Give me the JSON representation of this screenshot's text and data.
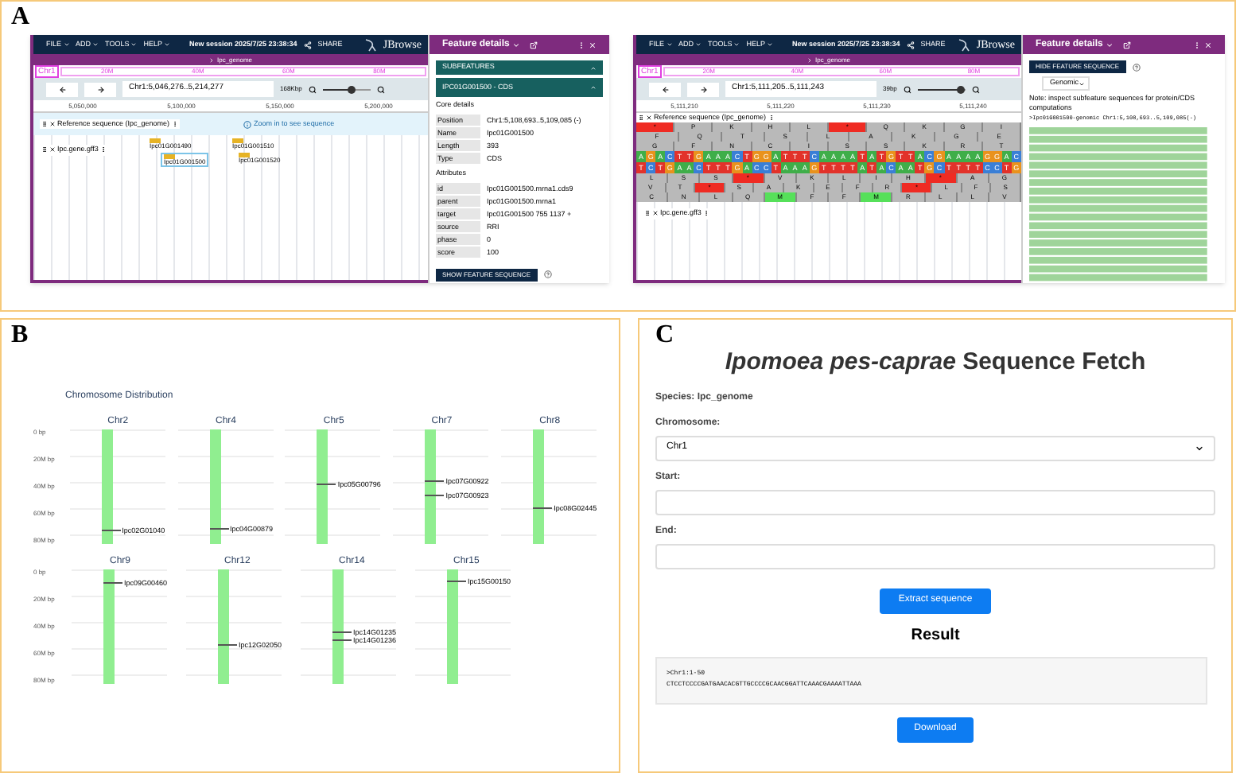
{
  "panel_a": {
    "label": "A",
    "browsers": [
      {
        "kind": "features",
        "menu": [
          "FILE",
          "ADD",
          "TOOLS",
          "HELP"
        ],
        "session": "New session 2025/7/25 23:38:34",
        "share": "SHARE",
        "brand": "JBrowse",
        "details_title": "Feature details",
        "assembly": "Ipc_genome",
        "chromosome": "Chr1",
        "overview_marks": [
          "20M",
          "40M",
          "60M",
          "80M"
        ],
        "locus": "Chr1:5,046,276..5,214,277",
        "zoom_reading": "168Kbp",
        "zoom": {
          "level": 0.6
        },
        "scale": [
          "5,050,000",
          "5,100,000",
          "5,150,000",
          "5,200,000"
        ],
        "reference_track": {
          "name": "Reference sequence (Ipc_genome)",
          "message": "Zoom in to see sequence"
        },
        "gene_track": {
          "name": "Ipc.gene.gff3",
          "features": [
            {
              "label": "Ipc01G001490",
              "selected": false
            },
            {
              "label": "Ipc01G001500",
              "selected": true
            },
            {
              "label": "Ipc01G001510",
              "selected": false
            },
            {
              "label": "Ipc01G001520",
              "selected": false
            }
          ]
        },
        "details": {
          "subfeatures": "SUBFEATURES",
          "feature_title": "IPC01G001500 - CDS",
          "core_title": "Core details",
          "core": [
            {
              "key": "Position",
              "value": "Chr1:5,108,693..5,109,085 (-)"
            },
            {
              "key": "Name",
              "value": "Ipc01G001500"
            },
            {
              "key": "Length",
              "value": "393"
            },
            {
              "key": "Type",
              "value": "CDS"
            }
          ],
          "attributes_title": "Attributes",
          "attributes": [
            {
              "key": "id",
              "value": "Ipc01G001500.mrna1.cds9"
            },
            {
              "key": "parent",
              "value": "Ipc01G001500.mrna1"
            },
            {
              "key": "target",
              "value": "Ipc01G001500 755 1137 +"
            },
            {
              "key": "source",
              "value": "RRI"
            },
            {
              "key": "phase",
              "value": "0"
            },
            {
              "key": "score",
              "value": "100"
            }
          ],
          "button": "SHOW FEATURE SEQUENCE"
        }
      },
      {
        "kind": "sequence",
        "menu": [
          "FILE",
          "ADD",
          "TOOLS",
          "HELP"
        ],
        "session": "New session 2025/7/25 23:38:34",
        "share": "SHARE",
        "brand": "JBrowse",
        "details_title": "Feature details",
        "assembly": "Ipc_genome",
        "chromosome": "Chr1",
        "overview_marks": [
          "20M",
          "40M",
          "60M",
          "80M"
        ],
        "locus": "Chr1:5,111,205..5,111,243",
        "zoom_reading": "39bp",
        "zoom": {
          "level": 0.9
        },
        "scale": [
          "5,111,210",
          "5,111,220",
          "5,111,230",
          "5,111,240"
        ],
        "reference_track": {
          "name": "Reference sequence (Ipc_genome)",
          "frames_top": [
            [
              "*",
              "P",
              "K",
              "H",
              "L",
              "*",
              "Q",
              "K",
              "G",
              "I"
            ],
            [
              "F",
              "Q",
              "T",
              "S",
              "L",
              "A",
              "K",
              "G",
              "E"
            ],
            [
              "G",
              "F",
              "N",
              "C",
              "I",
              "S",
              "S",
              "K",
              "R",
              "T"
            ]
          ],
          "forward": [
            "A",
            "G",
            "A",
            "C",
            "T",
            "T",
            "G",
            "A",
            "A",
            "A",
            "C",
            "T",
            "G",
            "G",
            "A",
            "T",
            "T",
            "T",
            "C",
            "A",
            "A",
            "A",
            "A",
            "T",
            "A",
            "T",
            "G",
            "T",
            "T",
            "A",
            "C",
            "G",
            "A",
            "A",
            "A",
            "A",
            "G",
            "G",
            "A",
            "C"
          ],
          "reverse": [
            "T",
            "C",
            "T",
            "G",
            "A",
            "A",
            "C",
            "T",
            "T",
            "T",
            "G",
            "A",
            "C",
            "C",
            "T",
            "A",
            "A",
            "A",
            "G",
            "T",
            "T",
            "T",
            "T",
            "A",
            "T",
            "A",
            "C",
            "A",
            "A",
            "T",
            "G",
            "C",
            "T",
            "T",
            "T",
            "T",
            "C",
            "C",
            "T",
            "G"
          ],
          "frames_bottom": [
            [
              "L",
              "S",
              "S",
              "*",
              "V",
              "K",
              "L",
              "I",
              "H",
              "*",
              "A",
              "G"
            ],
            [
              "V",
              "T",
              "*",
              "S",
              "A",
              "K",
              "E",
              "F",
              "R",
              "*",
              "L",
              "F",
              "S"
            ],
            [
              "C",
              "N",
              "L",
              "Q",
              "M",
              "F",
              "F",
              "M",
              "R",
              "L",
              "L",
              "V"
            ]
          ]
        },
        "gene_track": {
          "name": "Ipc.gene.gff3"
        },
        "details": {
          "button": "HIDE FEATURE SEQUENCE",
          "mode": "Genomic",
          "note": "Note: inspect subfeature sequences for protein/CDS computations",
          "header": ">Ipc01G001500-genomic Chr1:5,108,693..5,109,085(-)"
        }
      }
    ]
  },
  "panel_b": {
    "label": "B",
    "title": "Chromosome Distribution",
    "rows": [
      {
        "yticks": [
          "0 bp",
          "20M bp",
          "40M bp",
          "60M bp",
          "80M bp"
        ],
        "chromosomes": [
          {
            "name": "Chr2",
            "genes": [
              {
                "label": "Ipc02G01040",
                "level": 0.89
              }
            ]
          },
          {
            "name": "Chr4",
            "genes": [
              {
                "label": "Ipc04G00879",
                "level": 0.87
              }
            ]
          },
          {
            "name": "Chr5",
            "genes": [
              {
                "label": "Ipc05G00796",
                "level": 0.48
              }
            ]
          },
          {
            "name": "Chr7",
            "genes": [
              {
                "label": "Ipc07G00922",
                "level": 0.46
              },
              {
                "label": "Ipc07G00923",
                "level": 0.58
              }
            ]
          },
          {
            "name": "Chr8",
            "genes": [
              {
                "label": "Ipc08G02445",
                "level": 0.69
              }
            ]
          }
        ]
      },
      {
        "yticks": [
          "0 bp",
          "20M bp",
          "40M bp",
          "60M bp",
          "80M bp"
        ],
        "chromosomes": [
          {
            "name": "Chr9",
            "genes": [
              {
                "label": "Ipc09G00460",
                "level": 0.12
              }
            ]
          },
          {
            "name": "Chr12",
            "genes": [
              {
                "label": "Ipc12G02050",
                "level": 0.67
              }
            ]
          },
          {
            "name": "Chr14",
            "genes": [
              {
                "label": "Ipc14G01235",
                "level": 0.55
              },
              {
                "label": "Ipc14G01236",
                "level": 0.62
              }
            ]
          },
          {
            "name": "Chr15",
            "genes": [
              {
                "label": "Ipc15G00150",
                "level": 0.11
              }
            ]
          }
        ]
      }
    ]
  },
  "panel_c": {
    "label": "C",
    "title": "*Ipomoea pes-caprae* Sequence Fetch",
    "species": "Species: Ipc_genome",
    "chromosome_label": "Chromosome:",
    "chromosome_value": "Chr1",
    "start_label": "Start:",
    "end_label": "End:",
    "extract_button": "Extract sequence",
    "result_title": "Result",
    "result_lines": [
      ">Chr1:1-50",
      "CTCCTCCCCGATGAACACGTTGCCCCGCAACGGATTCAAACGAAAATTAAA"
    ],
    "download_button": "Download"
  }
}
